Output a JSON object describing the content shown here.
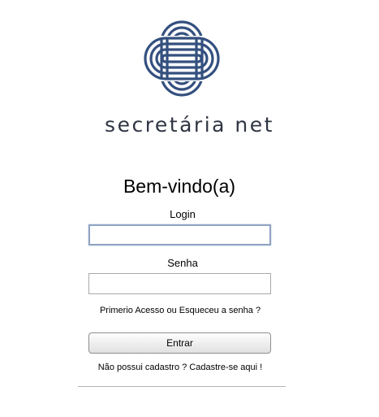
{
  "brand": {
    "name": "secretária net",
    "logo_icon": "interlaced-knot-logo-icon",
    "logo_color": "#34507f"
  },
  "form": {
    "welcome": "Bem-vindo(a)",
    "login_label": "Login",
    "login_value": "",
    "password_label": "Senha",
    "password_value": "",
    "forgot_link": "Primerio Acesso ou Esqueceu a senha ?",
    "submit_label": "Entrar",
    "register_link": "Não possui cadastro ? Cadastre-se aqui !"
  }
}
